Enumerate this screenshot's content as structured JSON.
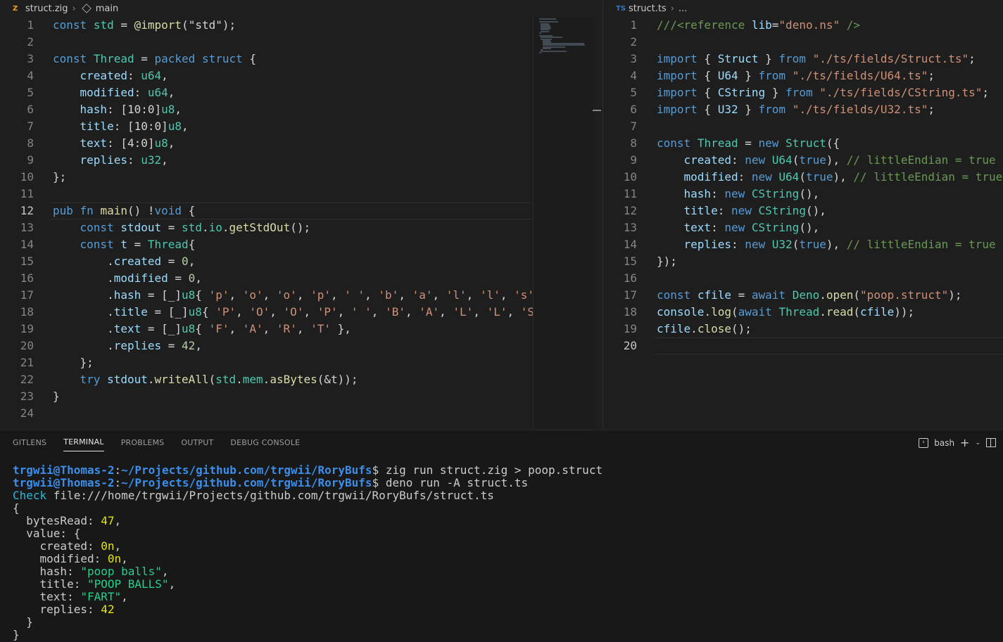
{
  "left_editor": {
    "file_name": "struct.zig",
    "file_icon": "zig-file-icon",
    "breadcrumb_symbol": "main",
    "active_line": 12,
    "lines": [
      [
        {
          "t": "const",
          "c": "kw"
        },
        {
          "t": " "
        },
        {
          "t": "std",
          "c": "ty"
        },
        {
          "t": " = "
        },
        {
          "t": "@import",
          "c": "fn"
        },
        {
          "t": "(\"std\");"
        }
      ],
      [],
      [
        {
          "t": "const",
          "c": "kw"
        },
        {
          "t": " "
        },
        {
          "t": "Thread",
          "c": "ty"
        },
        {
          "t": " = "
        },
        {
          "t": "packed struct",
          "c": "kw"
        },
        {
          "t": " {"
        }
      ],
      [
        {
          "t": "    created",
          "c": "prop"
        },
        {
          "t": ": "
        },
        {
          "t": "u64",
          "c": "ty"
        },
        {
          "t": ","
        }
      ],
      [
        {
          "t": "    modified",
          "c": "prop"
        },
        {
          "t": ": "
        },
        {
          "t": "u64",
          "c": "ty"
        },
        {
          "t": ","
        }
      ],
      [
        {
          "t": "    hash",
          "c": "prop"
        },
        {
          "t": ": [10:0]"
        },
        {
          "t": "u8",
          "c": "ty"
        },
        {
          "t": ","
        }
      ],
      [
        {
          "t": "    title",
          "c": "prop"
        },
        {
          "t": ": [10:0]"
        },
        {
          "t": "u8",
          "c": "ty"
        },
        {
          "t": ","
        }
      ],
      [
        {
          "t": "    text",
          "c": "prop"
        },
        {
          "t": ": [4:0]"
        },
        {
          "t": "u8",
          "c": "ty"
        },
        {
          "t": ","
        }
      ],
      [
        {
          "t": "    replies",
          "c": "prop"
        },
        {
          "t": ": "
        },
        {
          "t": "u32",
          "c": "ty"
        },
        {
          "t": ","
        }
      ],
      [
        {
          "t": "};"
        }
      ],
      [],
      [
        {
          "t": "pub fn",
          "c": "kw"
        },
        {
          "t": " "
        },
        {
          "t": "main",
          "c": "fn"
        },
        {
          "t": "() !"
        },
        {
          "t": "void",
          "c": "kw"
        },
        {
          "t": " {"
        }
      ],
      [
        {
          "t": "    "
        },
        {
          "t": "const",
          "c": "kw"
        },
        {
          "t": " "
        },
        {
          "t": "stdout",
          "c": "prop"
        },
        {
          "t": " = "
        },
        {
          "t": "std",
          "c": "ty"
        },
        {
          "t": "."
        },
        {
          "t": "io",
          "c": "ty"
        },
        {
          "t": "."
        },
        {
          "t": "getStdOut",
          "c": "fn"
        },
        {
          "t": "();"
        }
      ],
      [
        {
          "t": "    "
        },
        {
          "t": "const",
          "c": "kw"
        },
        {
          "t": " "
        },
        {
          "t": "t",
          "c": "prop"
        },
        {
          "t": " = "
        },
        {
          "t": "Thread",
          "c": "ty"
        },
        {
          "t": "{"
        }
      ],
      [
        {
          "t": "        ."
        },
        {
          "t": "created",
          "c": "prop"
        },
        {
          "t": " = "
        },
        {
          "t": "0",
          "c": "num"
        },
        {
          "t": ","
        }
      ],
      [
        {
          "t": "        ."
        },
        {
          "t": "modified",
          "c": "prop"
        },
        {
          "t": " = "
        },
        {
          "t": "0",
          "c": "num"
        },
        {
          "t": ","
        }
      ],
      [
        {
          "t": "        ."
        },
        {
          "t": "hash",
          "c": "prop"
        },
        {
          "t": " = [_]"
        },
        {
          "t": "u8",
          "c": "ty"
        },
        {
          "t": "{ "
        },
        {
          "t": "'p'",
          "c": "str"
        },
        {
          "t": ", "
        },
        {
          "t": "'o'",
          "c": "str"
        },
        {
          "t": ", "
        },
        {
          "t": "'o'",
          "c": "str"
        },
        {
          "t": ", "
        },
        {
          "t": "'p'",
          "c": "str"
        },
        {
          "t": ", "
        },
        {
          "t": "' '",
          "c": "str"
        },
        {
          "t": ", "
        },
        {
          "t": "'b'",
          "c": "str"
        },
        {
          "t": ", "
        },
        {
          "t": "'a'",
          "c": "str"
        },
        {
          "t": ", "
        },
        {
          "t": "'l'",
          "c": "str"
        },
        {
          "t": ", "
        },
        {
          "t": "'l'",
          "c": "str"
        },
        {
          "t": ", "
        },
        {
          "t": "'s'",
          "c": "str"
        },
        {
          "t": " },"
        }
      ],
      [
        {
          "t": "        ."
        },
        {
          "t": "title",
          "c": "prop"
        },
        {
          "t": " = [_]"
        },
        {
          "t": "u8",
          "c": "ty"
        },
        {
          "t": "{ "
        },
        {
          "t": "'P'",
          "c": "str"
        },
        {
          "t": ", "
        },
        {
          "t": "'O'",
          "c": "str"
        },
        {
          "t": ", "
        },
        {
          "t": "'O'",
          "c": "str"
        },
        {
          "t": ", "
        },
        {
          "t": "'P'",
          "c": "str"
        },
        {
          "t": ", "
        },
        {
          "t": "' '",
          "c": "str"
        },
        {
          "t": ", "
        },
        {
          "t": "'B'",
          "c": "str"
        },
        {
          "t": ", "
        },
        {
          "t": "'A'",
          "c": "str"
        },
        {
          "t": ", "
        },
        {
          "t": "'L'",
          "c": "str"
        },
        {
          "t": ", "
        },
        {
          "t": "'L'",
          "c": "str"
        },
        {
          "t": ", "
        },
        {
          "t": "'S'",
          "c": "str"
        },
        {
          "t": " },"
        }
      ],
      [
        {
          "t": "        ."
        },
        {
          "t": "text",
          "c": "prop"
        },
        {
          "t": " = [_]"
        },
        {
          "t": "u8",
          "c": "ty"
        },
        {
          "t": "{ "
        },
        {
          "t": "'F'",
          "c": "str"
        },
        {
          "t": ", "
        },
        {
          "t": "'A'",
          "c": "str"
        },
        {
          "t": ", "
        },
        {
          "t": "'R'",
          "c": "str"
        },
        {
          "t": ", "
        },
        {
          "t": "'T'",
          "c": "str"
        },
        {
          "t": " },"
        }
      ],
      [
        {
          "t": "        ."
        },
        {
          "t": "replies",
          "c": "prop"
        },
        {
          "t": " = "
        },
        {
          "t": "42",
          "c": "num"
        },
        {
          "t": ","
        }
      ],
      [
        {
          "t": "    };"
        }
      ],
      [
        {
          "t": "    "
        },
        {
          "t": "try",
          "c": "kw"
        },
        {
          "t": " "
        },
        {
          "t": "stdout",
          "c": "prop"
        },
        {
          "t": "."
        },
        {
          "t": "writeAll",
          "c": "fn"
        },
        {
          "t": "("
        },
        {
          "t": "std",
          "c": "ty"
        },
        {
          "t": "."
        },
        {
          "t": "mem",
          "c": "ty"
        },
        {
          "t": "."
        },
        {
          "t": "asBytes",
          "c": "fn"
        },
        {
          "t": "(&t));"
        }
      ],
      [
        {
          "t": "}"
        }
      ],
      []
    ]
  },
  "right_editor": {
    "file_name": "struct.ts",
    "file_icon": "ts-file-icon",
    "file_icon_text": "TS",
    "breadcrumb_symbol": "...",
    "active_line": 20,
    "lines": [
      [
        {
          "t": "///<reference",
          "c": "cmt"
        },
        {
          "t": " "
        },
        {
          "t": "lib",
          "c": "prop"
        },
        {
          "t": "="
        },
        {
          "t": "\"deno.ns\"",
          "c": "str"
        },
        {
          "t": " />",
          "c": "cmt"
        }
      ],
      [],
      [
        {
          "t": "import",
          "c": "kw"
        },
        {
          "t": " { "
        },
        {
          "t": "Struct",
          "c": "prop"
        },
        {
          "t": " } "
        },
        {
          "t": "from",
          "c": "kw"
        },
        {
          "t": " "
        },
        {
          "t": "\"./ts/fields/Struct.ts\"",
          "c": "str"
        },
        {
          "t": ";"
        }
      ],
      [
        {
          "t": "import",
          "c": "kw"
        },
        {
          "t": " { "
        },
        {
          "t": "U64",
          "c": "prop"
        },
        {
          "t": " } "
        },
        {
          "t": "from",
          "c": "kw"
        },
        {
          "t": " "
        },
        {
          "t": "\"./ts/fields/U64.ts\"",
          "c": "str"
        },
        {
          "t": ";"
        }
      ],
      [
        {
          "t": "import",
          "c": "kw"
        },
        {
          "t": " { "
        },
        {
          "t": "CString",
          "c": "prop"
        },
        {
          "t": " } "
        },
        {
          "t": "from",
          "c": "kw"
        },
        {
          "t": " "
        },
        {
          "t": "\"./ts/fields/CString.ts\"",
          "c": "str"
        },
        {
          "t": ";"
        }
      ],
      [
        {
          "t": "import",
          "c": "kw"
        },
        {
          "t": " { "
        },
        {
          "t": "U32",
          "c": "prop"
        },
        {
          "t": " } "
        },
        {
          "t": "from",
          "c": "kw"
        },
        {
          "t": " "
        },
        {
          "t": "\"./ts/fields/U32.ts\"",
          "c": "str"
        },
        {
          "t": ";"
        }
      ],
      [],
      [
        {
          "t": "const",
          "c": "kw"
        },
        {
          "t": " "
        },
        {
          "t": "Thread",
          "c": "ty"
        },
        {
          "t": " = "
        },
        {
          "t": "new",
          "c": "kw"
        },
        {
          "t": " "
        },
        {
          "t": "Struct",
          "c": "ty"
        },
        {
          "t": "({"
        }
      ],
      [
        {
          "t": "    created",
          "c": "prop"
        },
        {
          "t": ": "
        },
        {
          "t": "new",
          "c": "kw"
        },
        {
          "t": " "
        },
        {
          "t": "U64",
          "c": "ty"
        },
        {
          "t": "("
        },
        {
          "t": "true",
          "c": "kw"
        },
        {
          "t": "), "
        },
        {
          "t": "// littleEndian = true",
          "c": "cmt"
        }
      ],
      [
        {
          "t": "    modified",
          "c": "prop"
        },
        {
          "t": ": "
        },
        {
          "t": "new",
          "c": "kw"
        },
        {
          "t": " "
        },
        {
          "t": "U64",
          "c": "ty"
        },
        {
          "t": "("
        },
        {
          "t": "true",
          "c": "kw"
        },
        {
          "t": "), "
        },
        {
          "t": "// littleEndian = true",
          "c": "cmt"
        }
      ],
      [
        {
          "t": "    hash",
          "c": "prop"
        },
        {
          "t": ": "
        },
        {
          "t": "new",
          "c": "kw"
        },
        {
          "t": " "
        },
        {
          "t": "CString",
          "c": "ty"
        },
        {
          "t": "(),"
        }
      ],
      [
        {
          "t": "    title",
          "c": "prop"
        },
        {
          "t": ": "
        },
        {
          "t": "new",
          "c": "kw"
        },
        {
          "t": " "
        },
        {
          "t": "CString",
          "c": "ty"
        },
        {
          "t": "(),"
        }
      ],
      [
        {
          "t": "    text",
          "c": "prop"
        },
        {
          "t": ": "
        },
        {
          "t": "new",
          "c": "kw"
        },
        {
          "t": " "
        },
        {
          "t": "CString",
          "c": "ty"
        },
        {
          "t": "(),"
        }
      ],
      [
        {
          "t": "    replies",
          "c": "prop"
        },
        {
          "t": ": "
        },
        {
          "t": "new",
          "c": "kw"
        },
        {
          "t": " "
        },
        {
          "t": "U32",
          "c": "ty"
        },
        {
          "t": "("
        },
        {
          "t": "true",
          "c": "kw"
        },
        {
          "t": "), "
        },
        {
          "t": "// littleEndian = true",
          "c": "cmt"
        }
      ],
      [
        {
          "t": "});"
        }
      ],
      [],
      [
        {
          "t": "const",
          "c": "kw"
        },
        {
          "t": " "
        },
        {
          "t": "cfile",
          "c": "prop"
        },
        {
          "t": " = "
        },
        {
          "t": "await",
          "c": "kw"
        },
        {
          "t": " "
        },
        {
          "t": "Deno",
          "c": "ty"
        },
        {
          "t": "."
        },
        {
          "t": "open",
          "c": "fn"
        },
        {
          "t": "("
        },
        {
          "t": "\"poop.struct\"",
          "c": "str"
        },
        {
          "t": ");"
        }
      ],
      [
        {
          "t": "console",
          "c": "prop"
        },
        {
          "t": "."
        },
        {
          "t": "log",
          "c": "fn"
        },
        {
          "t": "("
        },
        {
          "t": "await",
          "c": "kw"
        },
        {
          "t": " "
        },
        {
          "t": "Thread",
          "c": "ty"
        },
        {
          "t": "."
        },
        {
          "t": "read",
          "c": "fn"
        },
        {
          "t": "("
        },
        {
          "t": "cfile",
          "c": "prop"
        },
        {
          "t": "));"
        }
      ],
      [
        {
          "t": "cfile",
          "c": "prop"
        },
        {
          "t": "."
        },
        {
          "t": "close",
          "c": "fn"
        },
        {
          "t": "();"
        }
      ],
      []
    ]
  },
  "panel": {
    "tabs": [
      {
        "label": "GITLENS",
        "active": false
      },
      {
        "label": "TERMINAL",
        "active": true
      },
      {
        "label": "PROBLEMS",
        "active": false
      },
      {
        "label": "OUTPUT",
        "active": false
      },
      {
        "label": "DEBUG CONSOLE",
        "active": false
      }
    ],
    "shell_name": "bash",
    "plus_icon": "+",
    "chevron_icon": "⌄"
  },
  "terminal": {
    "lines": [
      [
        {
          "t": "trgwii@Thomas-2",
          "c": "t-user"
        },
        {
          "t": ":"
        },
        {
          "t": "~/Projects/github.com/trgwii/RoryBufs",
          "c": "t-path"
        },
        {
          "t": "$ zig run struct.zig > poop.struct"
        }
      ],
      [
        {
          "t": "trgwii@Thomas-2",
          "c": "t-user"
        },
        {
          "t": ":"
        },
        {
          "t": "~/Projects/github.com/trgwii/RoryBufs",
          "c": "t-path"
        },
        {
          "t": "$ deno run -A struct.ts"
        }
      ],
      [
        {
          "t": "Check",
          "c": "t-check"
        },
        {
          "t": " file:///home/trgwii/Projects/github.com/trgwii/RoryBufs/struct.ts"
        }
      ],
      [
        {
          "t": "{"
        }
      ],
      [
        {
          "t": "  bytesRead: "
        },
        {
          "t": "47",
          "c": "t-num"
        },
        {
          "t": ","
        }
      ],
      [
        {
          "t": "  value: {"
        }
      ],
      [
        {
          "t": "    created: "
        },
        {
          "t": "0n",
          "c": "t-num"
        },
        {
          "t": ","
        }
      ],
      [
        {
          "t": "    modified: "
        },
        {
          "t": "0n",
          "c": "t-num"
        },
        {
          "t": ","
        }
      ],
      [
        {
          "t": "    hash: "
        },
        {
          "t": "\"poop balls\"",
          "c": "t-str"
        },
        {
          "t": ","
        }
      ],
      [
        {
          "t": "    title: "
        },
        {
          "t": "\"POOP BALLS\"",
          "c": "t-str"
        },
        {
          "t": ","
        }
      ],
      [
        {
          "t": "    text: "
        },
        {
          "t": "\"FART\"",
          "c": "t-str"
        },
        {
          "t": ","
        }
      ],
      [
        {
          "t": "    replies: "
        },
        {
          "t": "42",
          "c": "t-num"
        }
      ],
      [
        {
          "t": "  }"
        }
      ],
      [
        {
          "t": "}"
        }
      ]
    ]
  }
}
